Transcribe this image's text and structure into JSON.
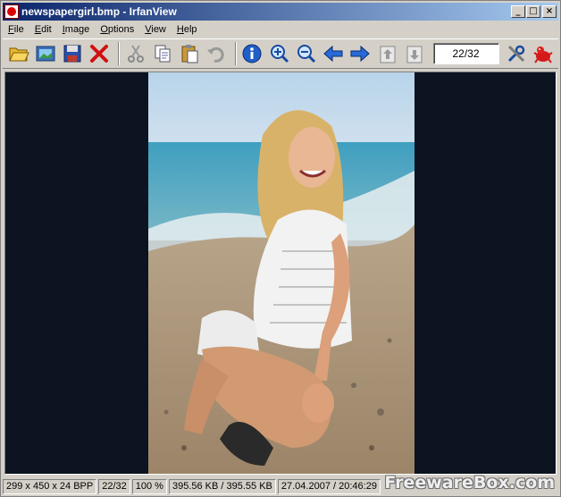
{
  "window": {
    "title": "newspapergirl.bmp - IrfanView",
    "controls": {
      "minimize": "_",
      "maximize": "□",
      "close": "×"
    }
  },
  "menu": [
    {
      "label": "File",
      "underline": "F",
      "rest": "ile"
    },
    {
      "label": "Edit",
      "underline": "E",
      "rest": "dit"
    },
    {
      "label": "Image",
      "underline": "I",
      "rest": "mage"
    },
    {
      "label": "Options",
      "underline": "O",
      "rest": "ptions"
    },
    {
      "label": "View",
      "underline": "V",
      "rest": "iew"
    },
    {
      "label": "Help",
      "underline": "H",
      "rest": "elp"
    }
  ],
  "toolbar": {
    "icons": [
      "open-folder-icon",
      "slideshow-icon",
      "save-icon",
      "delete-icon",
      "cut-icon",
      "copy-icon",
      "paste-icon",
      "undo-icon",
      "info-icon",
      "zoom-in-icon",
      "zoom-out-icon",
      "previous-icon",
      "next-icon",
      "first-page-icon",
      "last-page-icon",
      "settings-icon",
      "irfanview-logo-icon"
    ],
    "page_indicator": "22/32"
  },
  "status": {
    "dimensions": "299 x 450 x 24 BPP",
    "page": "22/32",
    "zoom": "100 %",
    "size": "395.56 KB / 395.55 KB",
    "datetime": "27.04.2007 / 20:46:29"
  },
  "watermark": "FreewareBox.com",
  "colors": {
    "title_start": "#0a246a",
    "title_end": "#a6caf0",
    "viewer_bg": "#0b1420",
    "chrome": "#d4d0c8"
  }
}
